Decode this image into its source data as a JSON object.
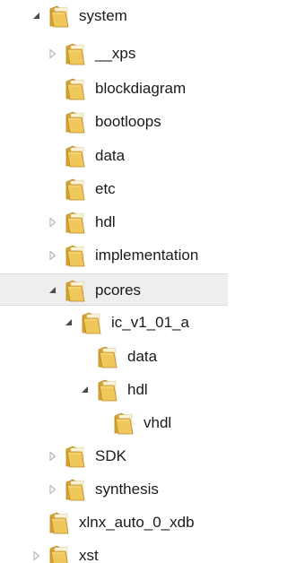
{
  "colors": {
    "folder_front": "#f0c75a",
    "folder_back": "#d9a532",
    "folder_edge": "#b88a25",
    "selected_row": "#eeeeee",
    "toggle_collapsed": "#b9b9b9",
    "toggle_expanded": "#4a4a4a"
  },
  "tree": {
    "items": [
      {
        "label": "system",
        "toggle": "expanded",
        "icon": "folder-icon"
      },
      {
        "label": "__xps",
        "toggle": "collapsed",
        "icon": "folder-icon"
      },
      {
        "label": "blockdiagram",
        "toggle": "none",
        "icon": "folder-icon"
      },
      {
        "label": "bootloops",
        "toggle": "none",
        "icon": "folder-icon"
      },
      {
        "label": "data",
        "toggle": "none",
        "icon": "folder-icon"
      },
      {
        "label": "etc",
        "toggle": "none",
        "icon": "folder-icon"
      },
      {
        "label": "hdl",
        "toggle": "collapsed",
        "icon": "folder-icon"
      },
      {
        "label": "implementation",
        "toggle": "collapsed",
        "icon": "folder-icon"
      },
      {
        "label": "pcores",
        "toggle": "expanded",
        "icon": "folder-icon",
        "selected": true
      },
      {
        "label": "ic_v1_01_a",
        "toggle": "expanded",
        "icon": "folder-icon"
      },
      {
        "label": "data",
        "toggle": "none",
        "icon": "folder-icon"
      },
      {
        "label": "hdl",
        "toggle": "expanded",
        "icon": "folder-icon"
      },
      {
        "label": "vhdl",
        "toggle": "none",
        "icon": "folder-icon"
      },
      {
        "label": "SDK",
        "toggle": "collapsed",
        "icon": "folder-icon"
      },
      {
        "label": "synthesis",
        "toggle": "collapsed",
        "icon": "folder-icon"
      },
      {
        "label": "xlnx_auto_0_xdb",
        "toggle": "none",
        "icon": "folder-icon"
      },
      {
        "label": "xst",
        "toggle": "collapsed",
        "icon": "folder-icon"
      }
    ]
  }
}
